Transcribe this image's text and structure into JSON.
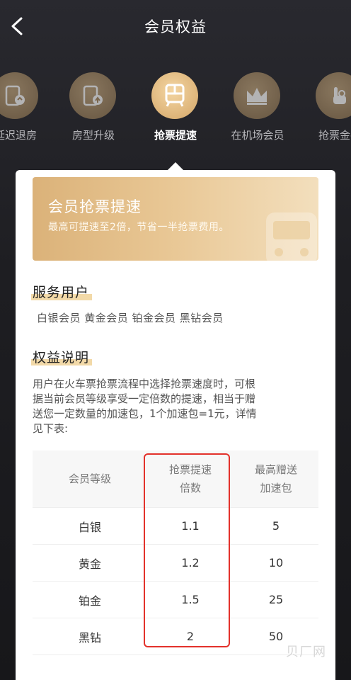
{
  "header": {
    "title": "会员权益",
    "back_icon": "chevron-left-icon"
  },
  "tabs": [
    {
      "label": "延迟退房",
      "icon": "checkout-icon",
      "active": false
    },
    {
      "label": "房型升级",
      "icon": "room-upgrade-icon",
      "active": false
    },
    {
      "label": "抢票提速",
      "icon": "train-icon",
      "active": true
    },
    {
      "label": "在机场会员",
      "icon": "crown-icon",
      "active": false
    },
    {
      "label": "抢票金手",
      "icon": "hand-icon",
      "active": false
    }
  ],
  "banner": {
    "title": "会员抢票提速",
    "subtitle": "最高可提速至2倍，节省一半抢票费用。"
  },
  "service_users": {
    "title": "服务用户",
    "members": "白银会员 黄金会员 铂金会员 黑钻会员"
  },
  "benefit": {
    "title": "权益说明",
    "desc_lines": [
      "用户在火车票抢票流程中选择抢票速度时，可根",
      "据当前会员等级享受一定倍数的提速，相当于赠",
      "送您一定数量的加速包，1个加速包=1元，详情",
      "见下表:"
    ]
  },
  "table": {
    "headers": {
      "level": "会员等级",
      "speed_l1": "抢票提速",
      "speed_l2": "倍数",
      "pack_l1": "最高赠送",
      "pack_l2": "加速包"
    },
    "rows": [
      {
        "level": "白银",
        "speed": "1.1",
        "pack": "5"
      },
      {
        "level": "黄金",
        "speed": "1.2",
        "pack": "10"
      },
      {
        "level": "铂金",
        "speed": "1.5",
        "pack": "25"
      },
      {
        "level": "黑钻",
        "speed": "2",
        "pack": "50"
      }
    ]
  },
  "watermark": "贝厂网",
  "colors": {
    "accent_gold": "#d3a567",
    "highlight": "#f2d9a8",
    "red_box": "#e3322b"
  }
}
